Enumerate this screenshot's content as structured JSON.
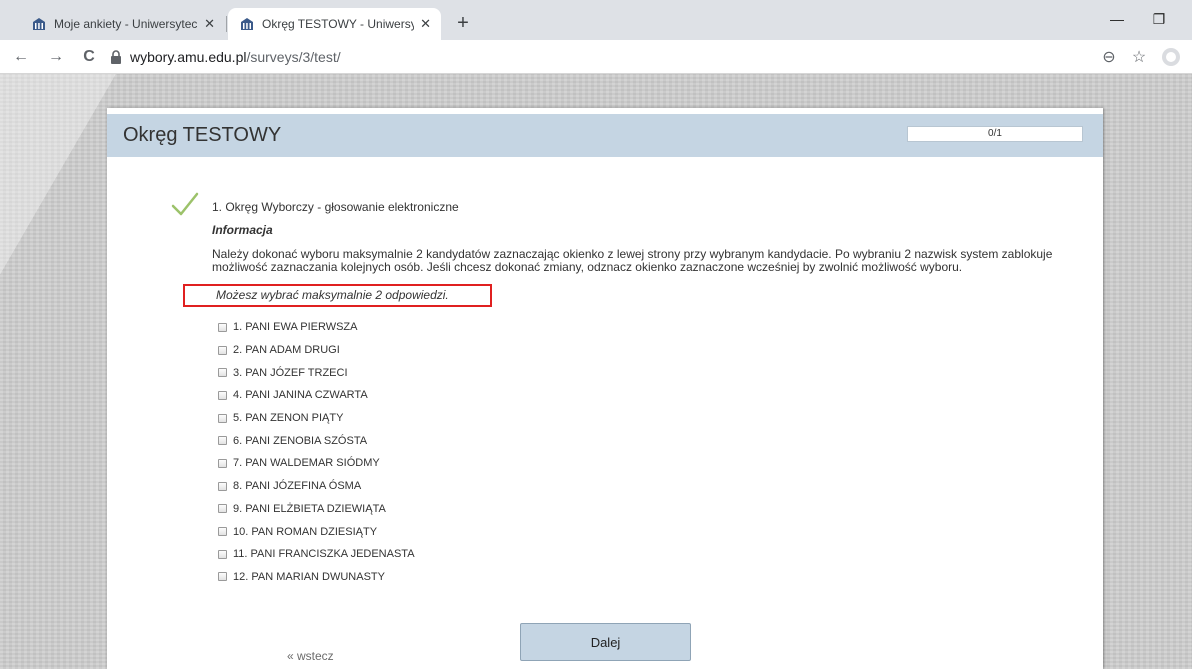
{
  "browser": {
    "tabs": [
      {
        "title": "Moje ankiety - Uniwersytecki Sys",
        "active": false
      },
      {
        "title": "Okręg TESTOWY - Uniwersytecki",
        "active": true
      }
    ],
    "close_glyph": "✕",
    "new_tab_glyph": "+",
    "url_host": "wybory.amu.edu.pl",
    "url_path": "/surveys/3/test/",
    "icons": {
      "back": "←",
      "forward": "→",
      "reload": "C",
      "zoom": "⊖",
      "star": "☆",
      "minimize": "—",
      "restore": "❐"
    }
  },
  "survey": {
    "title": "Okręg TESTOWY",
    "progress": "0/1",
    "progress_fraction": 0,
    "question_title": "1. Okręg Wyborczy - głosowanie elektroniczne",
    "info_heading": "Informacja",
    "info_text": "Należy dokonać wyboru maksymalnie 2 kandydatów zaznaczając okienko z lewej strony przy wybranym kandydacie. Po wybraniu 2 nazwisk system zablokuje możliwość zaznaczania kolejnych osób. Jeśli chcesz dokonać zmiany, odznacz okienko zaznaczone wcześniej by zwolnić możliwość wyboru.",
    "hint": "Możesz wybrać maksymalnie 2 odpowiedzi.",
    "options": [
      {
        "label": "1. PANI EWA PIERWSZA",
        "checked": false
      },
      {
        "label": "2. PAN ADAM DRUGI",
        "checked": false
      },
      {
        "label": "3. PAN JÓZEF TRZECI",
        "checked": false
      },
      {
        "label": "4. PANI JANINA CZWARTA",
        "checked": false
      },
      {
        "label": "5. PAN ZENON PIĄTY",
        "checked": false
      },
      {
        "label": "6. PANI ZENOBIA SZÓSTA",
        "checked": false
      },
      {
        "label": "7. PAN WALDEMAR SIÓDMY",
        "checked": false
      },
      {
        "label": "8. PANI JÓZEFINA ÓSMA",
        "checked": false
      },
      {
        "label": "9. PANI ELŻBIETA DZIEWIĄTA",
        "checked": false
      },
      {
        "label": "10. PAN ROMAN DZIESIĄTY",
        "checked": false
      },
      {
        "label": "11. PANI FRANCISZKA JEDENASTA",
        "checked": false
      },
      {
        "label": "12. PAN MARIAN DWUNASTY",
        "checked": false
      }
    ],
    "back_label": "« wstecz",
    "next_label": "Dalej"
  },
  "colors": {
    "header_bg": "#c5d5e3",
    "hint_border": "#e02020",
    "check_green": "#9cc26a"
  }
}
